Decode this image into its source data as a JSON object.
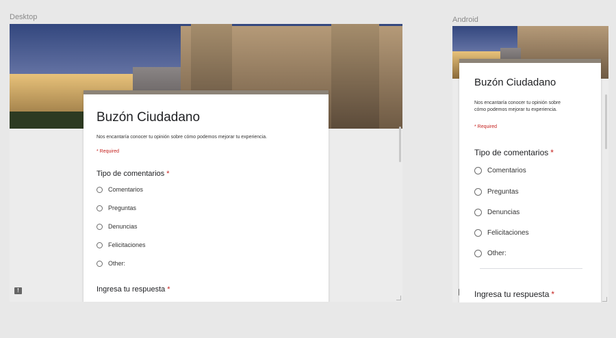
{
  "desktop": {
    "caption": "Desktop",
    "form": {
      "title": "Buzón Ciudadano",
      "description": "Nos encantaría conocer tu opinión sobre cómo podemos mejorar tu experiencia.",
      "required_note": "* Required",
      "question1": {
        "label": "Tipo de comentarios",
        "star": "*",
        "options": [
          "Comentarios",
          "Preguntas",
          "Denuncias",
          "Felicitaciones",
          "Other:"
        ]
      },
      "question2": {
        "label": "Ingresa tu respuesta",
        "star": "*"
      }
    },
    "feedback_icon": "feedback-icon"
  },
  "android": {
    "caption": "Android",
    "form": {
      "title": "Buzón Ciudadano",
      "description_line1": "Nos encantaría conocer tu opinión sobre",
      "description_line2": "cómo podemos mejorar tu experiencia.",
      "required_note": "* Required",
      "question1": {
        "label": "Tipo de comentarios",
        "star": "*",
        "options": [
          "Comentarios",
          "Preguntas",
          "Denuncias",
          "Felicitaciones",
          "Other:"
        ]
      },
      "question2": {
        "label": "Ingresa tu respuesta",
        "star": "*"
      }
    },
    "feedback_icon": "feedback-icon"
  }
}
